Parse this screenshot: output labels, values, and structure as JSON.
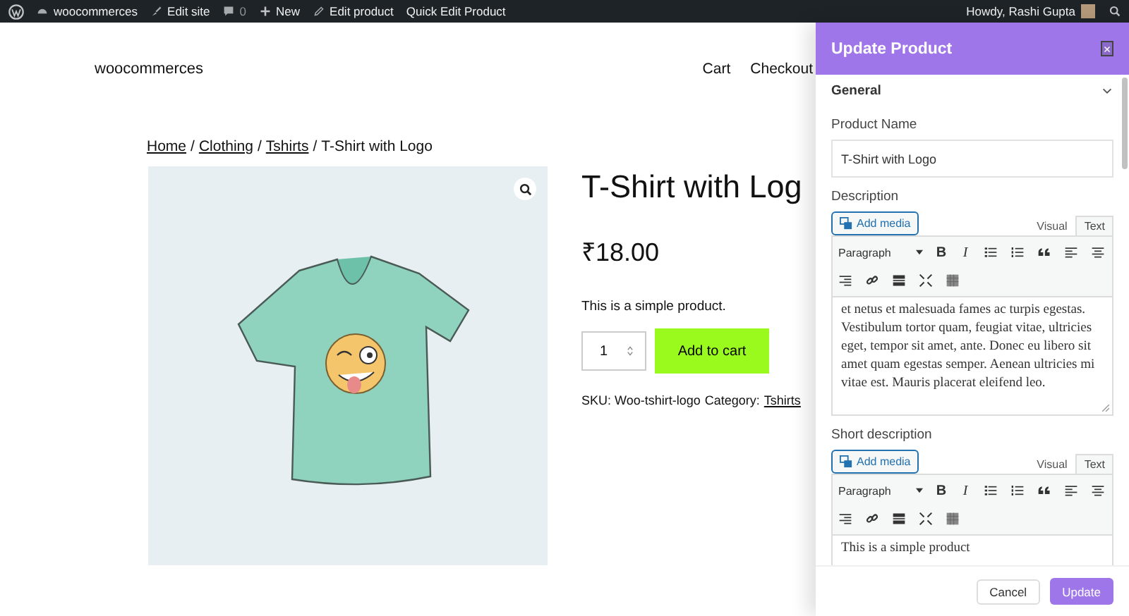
{
  "admin_bar": {
    "items": [
      {
        "kind": "home",
        "label": "woocommerces"
      },
      {
        "kind": "brush",
        "label": "Edit site"
      },
      {
        "kind": "comment",
        "label": "0"
      },
      {
        "kind": "plus",
        "label": "New"
      },
      {
        "kind": "pencil",
        "label": "Edit product"
      },
      {
        "kind": "none",
        "label": "Quick Edit Product"
      }
    ],
    "greeting": "Howdy, Rashi Gupta"
  },
  "site": {
    "title": "woocommerces",
    "nav": [
      "Cart",
      "Checkout"
    ]
  },
  "breadcrumb": {
    "separator": "/",
    "items": [
      {
        "label": "Home",
        "link": true
      },
      {
        "label": "Clothing",
        "link": true
      },
      {
        "label": "Tshirts",
        "link": true
      },
      {
        "label": "T-Shirt with Logo",
        "link": false
      }
    ]
  },
  "product": {
    "title": "T-Shirt with Log",
    "price": "₹18.00",
    "summary": "This is a simple product.",
    "quantity": "1",
    "add_to_cart": "Add to cart",
    "sku": "SKU: Woo-tshirt-logo",
    "category_label": "Category:",
    "category": "Tshirts"
  },
  "panel": {
    "title": "Update Product",
    "close": "×",
    "section": {
      "label": "General",
      "expanded": true
    },
    "product_name": {
      "label": "Product Name",
      "value": "T-Shirt with Logo"
    },
    "editors": [
      {
        "label": "Description",
        "add_media": "Add media",
        "tabs": [
          {
            "label": "Visual",
            "selected": false
          },
          {
            "label": "Text",
            "selected": true
          }
        ],
        "format": "Paragraph",
        "bold": "B",
        "italic": "I",
        "content": "et netus et malesuada fames ac turpis egestas. Vestibulum tortor quam, feugiat vitae, ultricies eget, tempor sit amet, ante. Donec eu libero sit amet quam egestas semper. Aenean ultricies mi vitae est. Mauris placerat eleifend leo."
      },
      {
        "label": "Short description",
        "add_media": "Add media",
        "tabs": [
          {
            "label": "Visual",
            "selected": false
          },
          {
            "label": "Text",
            "selected": true
          }
        ],
        "format": "Paragraph",
        "bold": "B",
        "italic": "I",
        "content": "This is a simple product"
      }
    ],
    "cancel": "Cancel",
    "update": "Update"
  }
}
